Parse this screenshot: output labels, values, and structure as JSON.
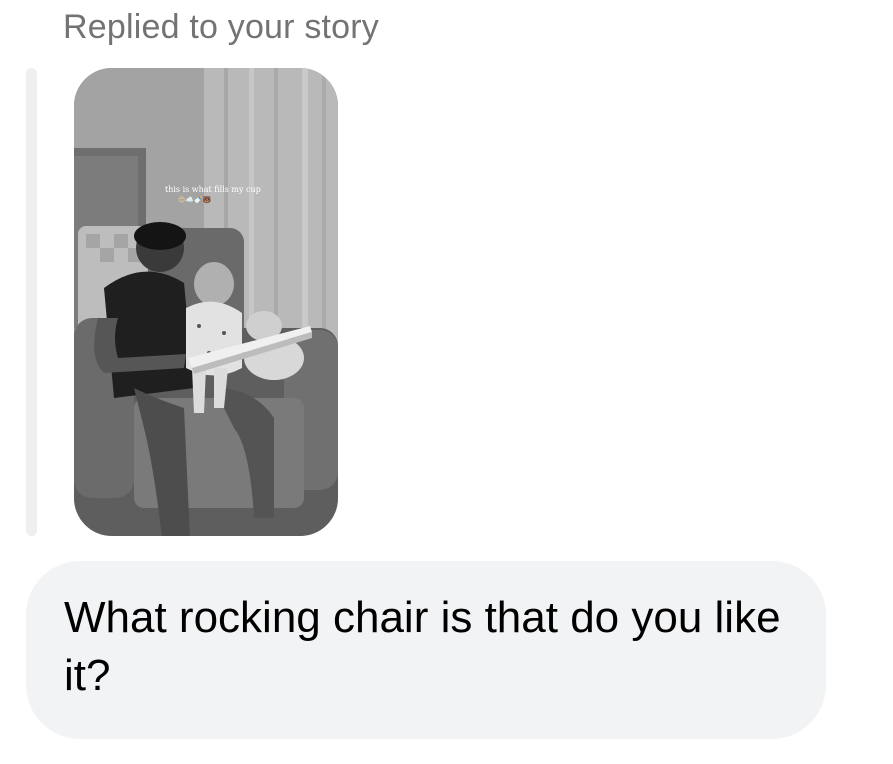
{
  "reply": {
    "label": "Replied to your story"
  },
  "story": {
    "caption": "this is what fills my cup",
    "caption_emojis": "😍☁️🍼🐻"
  },
  "message": {
    "text": "What rocking chair is that do you like it?"
  },
  "colors": {
    "label_gray": "#737373",
    "reply_bar": "#efefef",
    "bubble_bg": "#f2f3f5",
    "text_black": "#000000"
  }
}
